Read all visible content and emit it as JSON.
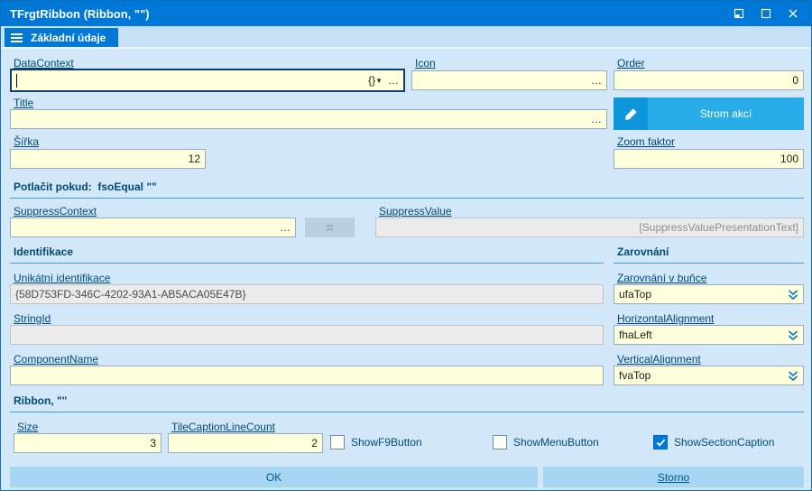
{
  "colors": {
    "accent": "#0078d7",
    "field_bg": "#ffffdc",
    "content_bg": "#d2e7f7"
  },
  "window": {
    "title": "TFrgtRibbon (Ribbon, \"\")"
  },
  "tabs": {
    "active": "Základní údaje"
  },
  "form": {
    "data_context": {
      "label": "DataContext",
      "value": "",
      "braces_glyph": "{}",
      "ellipsis": "…"
    },
    "icon": {
      "label": "Icon",
      "value": "",
      "ellipsis": "…"
    },
    "order": {
      "label": "Order",
      "value": "0"
    },
    "title": {
      "label": "Title",
      "value": "",
      "ellipsis": "…"
    },
    "action_tree_button": {
      "label": "Strom akcí"
    },
    "width": {
      "label": "Šířka",
      "value": "12"
    },
    "zoom": {
      "label": "Zoom faktor",
      "value": "100"
    },
    "suppress_section_title": "Potlačit pokud:  fsoEqual \"\"",
    "suppress_context": {
      "label": "SuppressContext",
      "value": "",
      "ellipsis": "…"
    },
    "equals_button": "=",
    "suppress_value": {
      "label": "SuppressValue",
      "value": "[SuppressValuePresentationText]"
    },
    "identification_section_title": "Identifikace",
    "alignment_section_title": "Zarovnání",
    "unique_id": {
      "label": "Unikátní identifikace",
      "value": "{58D753FD-346C-4202-93A1-AB5ACA05E47B}"
    },
    "cell_alignment": {
      "label": "Zarovnání v buňce",
      "value": "ufaTop"
    },
    "string_id": {
      "label": "StringId",
      "value": ""
    },
    "horizontal_alignment": {
      "label": "HorizontalAlignment",
      "value": "fhaLeft"
    },
    "component_name": {
      "label": "ComponentName",
      "value": ""
    },
    "vertical_alignment": {
      "label": "VerticalAlignment",
      "value": "fvaTop"
    },
    "ribbon_section_title": "Ribbon, \"\"",
    "size": {
      "label": "Size",
      "value": "3"
    },
    "tile_caption_line_count": {
      "label": "TileCaptionLineCount",
      "value": "2"
    },
    "checkboxes": [
      {
        "label": "ShowF9Button",
        "checked": false
      },
      {
        "label": "ShowMenuButton",
        "checked": false
      },
      {
        "label": "ShowSectionCaption",
        "checked": true
      }
    ],
    "ok_button": "OK",
    "cancel_button": "Storno"
  }
}
